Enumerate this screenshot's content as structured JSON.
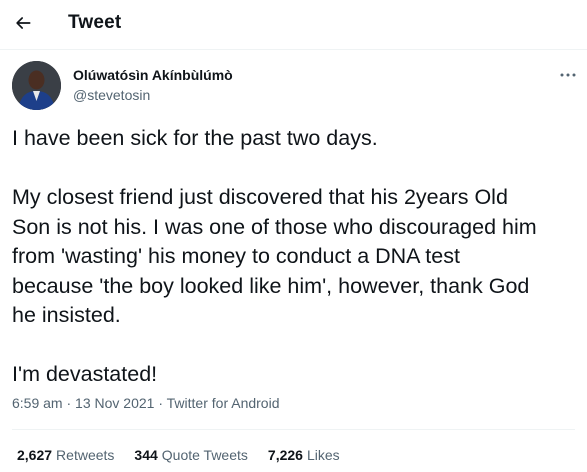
{
  "header": {
    "title": "Tweet",
    "back_icon": "arrow-left-icon"
  },
  "author": {
    "name": "Olúwatósìn Akínbùlúmò",
    "handle": "@stevetosin",
    "more_icon": "ellipsis-icon"
  },
  "tweet": {
    "text": "I have been sick for the past two days.\n\nMy closest friend just discovered that his 2years Old\nSon is not his. I was one of those who discouraged him\nfrom 'wasting' his money to conduct a DNA test\nbecause 'the boy looked like him', however, thank God\nhe insisted.\n\nI'm devastated!",
    "time": "6:59 am",
    "date": "13 Nov 2021",
    "source": "Twitter for Android",
    "separator": "·"
  },
  "stats": {
    "retweets_count": "2,627",
    "retweets_label": "Retweets",
    "quotes_count": "344",
    "quotes_label": "Quote Tweets",
    "likes_count": "7,226",
    "likes_label": "Likes"
  },
  "colors": {
    "text_primary": "#0f1419",
    "text_secondary": "#536471",
    "divider": "#eff3f4",
    "background": "#ffffff"
  }
}
